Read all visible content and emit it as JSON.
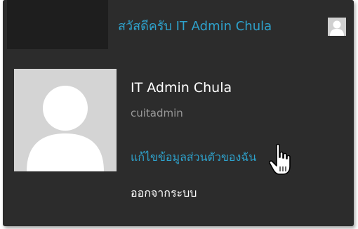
{
  "toolbar": {
    "greeting": "สวัสดีครับ IT Admin Chula"
  },
  "profile": {
    "display_name": "IT Admin Chula",
    "username": "cuitadmin",
    "edit_profile_label": "แก้ไขข้อมูลส่วนตัวของฉัน",
    "logout_label": "ออกจากระบบ"
  },
  "icons": {
    "mini_avatar": "avatar-placeholder-icon",
    "avatar": "avatar-placeholder-icon",
    "cursor": "hand-pointer-cursor-icon"
  },
  "colors": {
    "panel_bg": "#2c2c2c",
    "link": "#2ea2cc",
    "text": "#ffffff",
    "muted": "#9a9a9a",
    "avatar_bg": "#d4d4d4"
  }
}
